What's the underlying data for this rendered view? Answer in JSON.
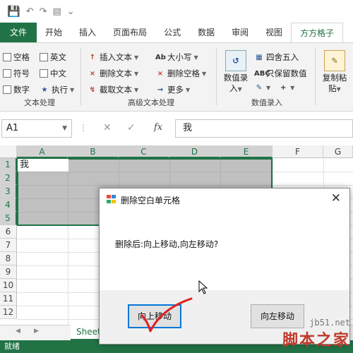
{
  "ribbon_tabs": [
    "文件",
    "开始",
    "插入",
    "页面布局",
    "公式",
    "数据",
    "审阅",
    "视图",
    "方方格子"
  ],
  "active_tab": "方方格子",
  "text_group": {
    "items": [
      "空格",
      "英文",
      "符号",
      "中文",
      "数字",
      "执行"
    ],
    "label": "文本处理"
  },
  "adv_group": {
    "items": [
      "插入文本",
      "大小写",
      "删除文本",
      "删除空格",
      "截取文本",
      "更多"
    ],
    "label": "高级文本处理"
  },
  "num_group": {
    "big_button": [
      "数值录",
      "入"
    ],
    "items": [
      "四舍五入",
      "只保留数值"
    ],
    "label": "数值录入"
  },
  "paste_button": [
    "复制粘",
    "贴"
  ],
  "formula_bar": {
    "name_box": "A1",
    "fx": "fx",
    "content": "我"
  },
  "columns": [
    "A",
    "B",
    "C",
    "D",
    "E",
    "F",
    "G"
  ],
  "rows": [
    "1",
    "2",
    "3",
    "4",
    "5",
    "6",
    "7",
    "8",
    "9",
    "10",
    "11",
    "12"
  ],
  "cell_a1": "我",
  "sheet_tab": "Sheet1",
  "status_text": "就绪",
  "dialog": {
    "title": "删除空白单元格",
    "message": "删除后:向上移动,向左移动?",
    "button_up": "向上移动",
    "button_left": "向左移动"
  },
  "watermark": {
    "line1": "jb51.net",
    "line2": "脚本之家"
  },
  "colors": {
    "excel_green": "#217346",
    "dialog_focus": "#0078d7",
    "annotation_red": "#e02020"
  }
}
